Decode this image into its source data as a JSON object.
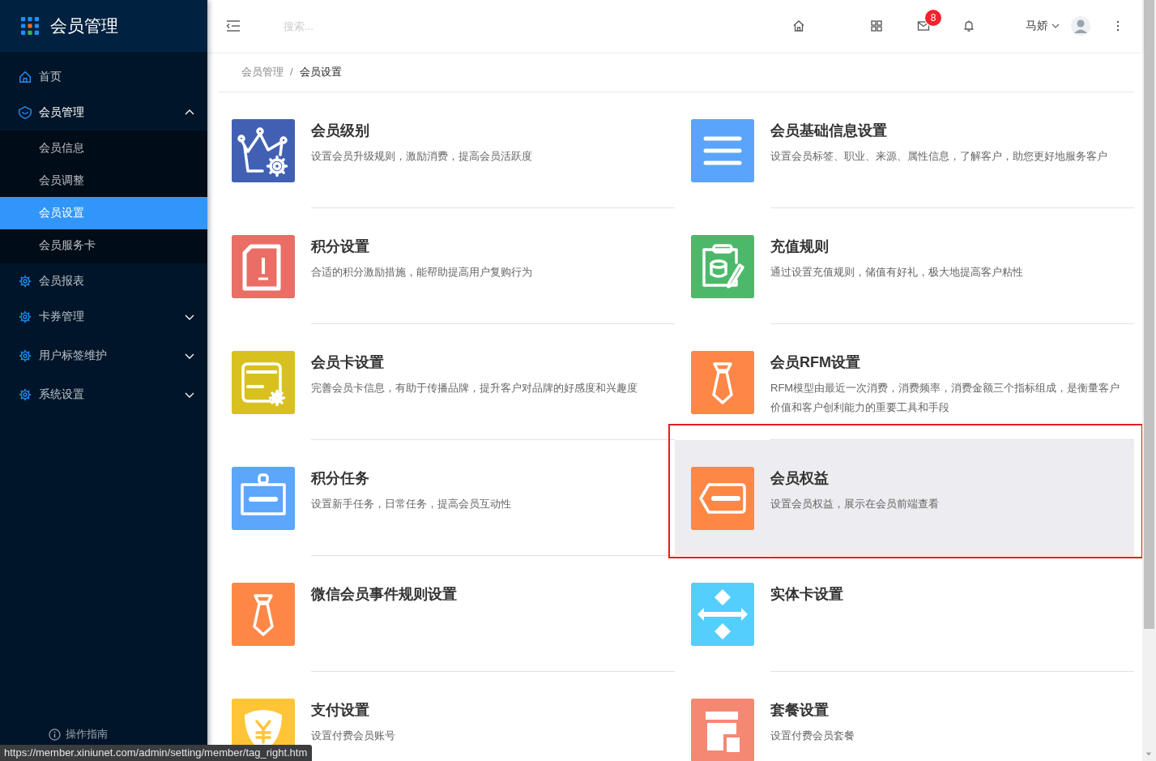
{
  "app": {
    "title": "会员管理"
  },
  "sidebar": {
    "items": [
      {
        "label": "首页",
        "selected": false
      },
      {
        "label": "会员管理",
        "selected": false,
        "expanded": true,
        "children": [
          {
            "label": "会员信息",
            "selected": false
          },
          {
            "label": "会员调整",
            "selected": false
          },
          {
            "label": "会员设置",
            "selected": true
          },
          {
            "label": "会员服务卡",
            "selected": false
          }
        ]
      },
      {
        "label": "会员报表",
        "selected": false
      },
      {
        "label": "卡券管理",
        "selected": false,
        "expanded": false
      },
      {
        "label": "用户标签维护",
        "selected": false,
        "expanded": false
      },
      {
        "label": "系统设置",
        "selected": false,
        "expanded": false
      }
    ],
    "footer": "操作指南"
  },
  "header": {
    "search": {
      "placeholder": "搜索..."
    },
    "mail_badge": "8",
    "user": {
      "name": "马娇"
    }
  },
  "breadcrumb": {
    "separator": "/",
    "items": [
      {
        "label": "会员管理",
        "current": false
      },
      {
        "label": "会员设置",
        "current": true
      }
    ]
  },
  "settings": [
    {
      "title": "会员级别",
      "description": "设置会员升级规则，激励消费，提高会员活跃度",
      "color": "#4160b4",
      "highlighted": false
    },
    {
      "title": "会员基础信息设置",
      "description": "设置会员标签、职业、来源、属性信息，了解客户，助您更好地服务客户",
      "color": "#5aa4fb",
      "highlighted": false
    },
    {
      "title": "积分设置",
      "description": "合适的积分激励措施，能帮助提高用户复购行为",
      "color": "#ea6e66",
      "highlighted": false
    },
    {
      "title": "充值规则",
      "description": "通过设置充值规则，储值有好礼，极大地提高客户粘性",
      "color": "#4cb96a",
      "highlighted": false
    },
    {
      "title": "会员卡设置",
      "description": "完善会员卡信息，有助于传播品牌，提升客户对品牌的好感度和兴趣度",
      "color": "#d8c11f",
      "highlighted": false
    },
    {
      "title": "会员RFM设置",
      "description": "RFM模型由最近一次消费，消费频率，消费金额三个指标组成，是衡量客户价值和客户创利能力的重要工具和手段",
      "color": "#fe8647",
      "highlighted": false
    },
    {
      "title": "积分任务",
      "description": "设置新手任务，日常任务，提高会员互动性",
      "color": "#5ca6fb",
      "highlighted": false
    },
    {
      "title": "会员权益",
      "description": "设置会员权益，展示在会员前端查看",
      "color": "#fe8746",
      "highlighted": true
    },
    {
      "title": "微信会员事件规则设置",
      "color": "#fe8748",
      "highlighted": false
    },
    {
      "title": "实体卡设置",
      "color": "#54cefd",
      "highlighted": false
    },
    {
      "title": "支付设置",
      "description": "设置付费会员账号",
      "color": "#ffc537",
      "highlighted": false
    },
    {
      "title": "套餐设置",
      "description": "设置付费会员套餐",
      "color": "#f48873",
      "highlighted": false
    }
  ],
  "status_bar": {
    "url": "https://member.xiniunet.com/admin/setting/member/tag_right.htm"
  }
}
